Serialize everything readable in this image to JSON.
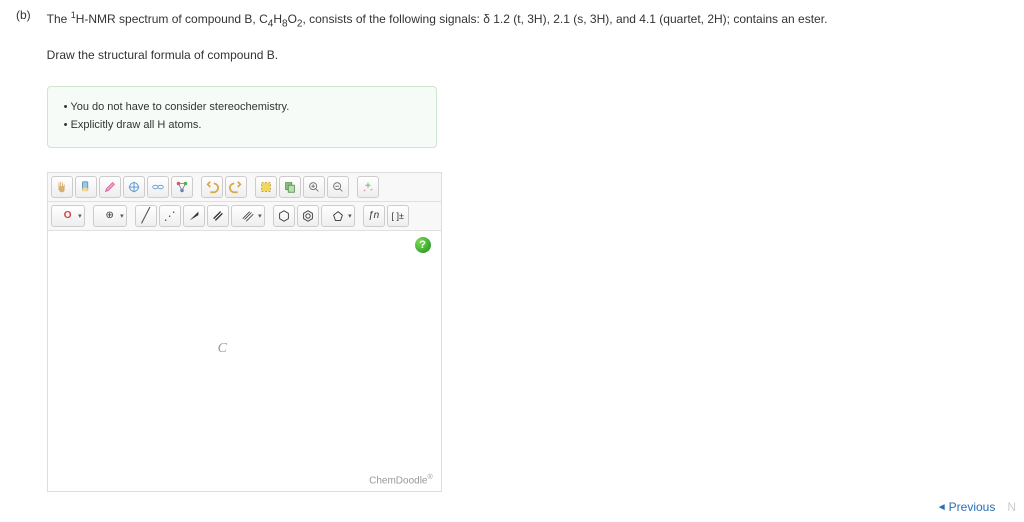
{
  "part": "(b)",
  "question_html_parts": {
    "pre": "The ",
    "sup1": "1",
    "mid1": "H-NMR spectrum of compound B, C",
    "sub4": "4",
    "mid2": "H",
    "sub8": "8",
    "mid3": "O",
    "sub2": "2",
    "post": ", consists of the following signals: δ 1.2 (t, 3H), 2.1 (s, 3H), and 4.1 (quartet, 2H); contains an ester."
  },
  "subprompt": "Draw the structural formula of compound B.",
  "hints": [
    "You do not have to consider stereochemistry.",
    "Explicitly draw all H atoms."
  ],
  "toolbar1": {
    "hand": "hand",
    "eraser": "eraser",
    "pencil": "pencil",
    "move": "move",
    "chain": "chain",
    "bonds": "bonds",
    "undo": "undo",
    "redo": "redo",
    "select": "select",
    "copy": "copy",
    "zoomin": "zoomin",
    "zoomout": "zoomout",
    "clean": "clean"
  },
  "toolbar2": {
    "o_label": "O",
    "plus_label": "⊕",
    "single": "/",
    "dotted": "⋰",
    "wedge": "▲",
    "double": "∥",
    "triple": "⦀",
    "ring1": "⬡",
    "ring2": "⬡",
    "ring3": "⬠",
    "fn": "ƒn",
    "bracket": "[ ]±"
  },
  "canvas": {
    "atom": "C",
    "brand": "ChemDoodle",
    "brand_sup": "®",
    "help": "?"
  },
  "footer": {
    "prev": "Previous",
    "next": "N"
  }
}
